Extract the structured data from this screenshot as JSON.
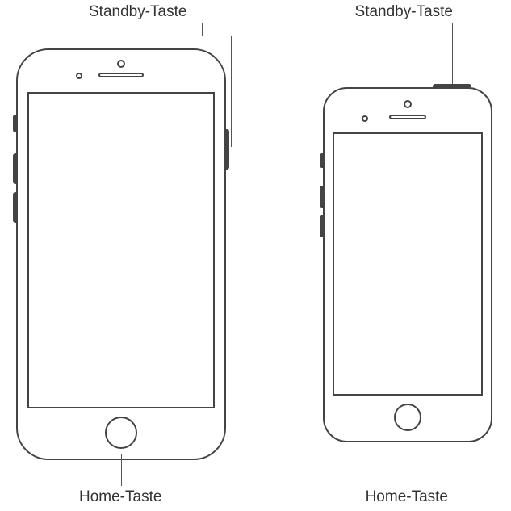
{
  "labels": {
    "standby_left": "Standby-Taste",
    "standby_right": "Standby-Taste",
    "home_left": "Home-Taste",
    "home_right": "Home-Taste"
  }
}
